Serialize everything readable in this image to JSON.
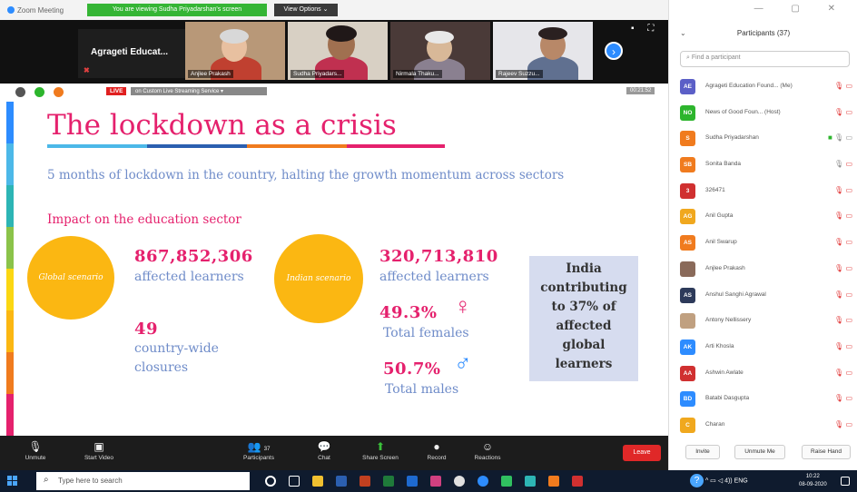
{
  "window": {
    "app_title": "Zoom Meeting",
    "viewing_banner": "You are viewing Sudha Priyadarshan's screen",
    "view_options": "View Options ⌄"
  },
  "thumbnails": {
    "host_tile": "Agrageti Educat...",
    "tiles": [
      {
        "name": "Anjlee Prakash"
      },
      {
        "name": "Sudha Priyadars..."
      },
      {
        "name": "Nirmala Thaku..."
      },
      {
        "name": "Rajeev Suzzu..."
      }
    ]
  },
  "livebar": {
    "live": "LIVE",
    "stream_text": "on Custom Live Streaming Service ▾",
    "time": "00:21:52"
  },
  "slide": {
    "title": "The lockdown as a crisis",
    "subtitle": "5 months of lockdown in the country, halting the growth momentum across sectors",
    "impact_heading": "Impact on the education sector",
    "global_label": "Global scenario",
    "indian_label": "Indian scenario",
    "global_learners_number": "867,852,306",
    "global_learners_label": "affected learners",
    "closures_number": "49",
    "closures_label_1": "country-wide",
    "closures_label_2": "closures",
    "india_learners_number": "320,713,810",
    "india_learners_label": "affected learners",
    "female_pct": "49.3%",
    "female_label": "Total females",
    "male_pct": "50.7%",
    "male_label": "Total males",
    "female_symbol": "♀",
    "male_symbol": "♂",
    "callout_lines": [
      "India",
      "contributing",
      "to 37% of",
      "affected",
      "global",
      "learners"
    ]
  },
  "toolbar": {
    "unmute": "Unmute",
    "start_video": "Start Video",
    "participants": "Participants",
    "participants_count": "37",
    "chat": "Chat",
    "share_screen": "Share Screen",
    "record": "Record",
    "reactions": "Reactions",
    "leave": "Leave"
  },
  "panel": {
    "title": "Participants (37)",
    "search_placeholder": "Find a participant",
    "participants": [
      {
        "initials": "AE",
        "name": "Agrageti Education Found... (Me)",
        "color": "#5b5fc7"
      },
      {
        "initials": "NO",
        "name": "News of Good Foun... (Host)",
        "color": "#2db52d"
      },
      {
        "initials": "S",
        "name": "Sudha Priyadarshan",
        "color": "#f07b1e"
      },
      {
        "initials": "SB",
        "name": "Sonita Banda",
        "color": "#f07b1e"
      },
      {
        "initials": "3",
        "name": "326471",
        "color": "#d03030"
      },
      {
        "initials": "AG",
        "name": "Anil Gupta",
        "color": "#f0a81e"
      },
      {
        "initials": "AS",
        "name": "Anil Swarup",
        "color": "#f07b1e"
      },
      {
        "initials": "",
        "name": "Anjlee Prakash",
        "color": "#8a6a5a"
      },
      {
        "initials": "AS",
        "name": "Anshul Sanghi Agrawal",
        "color": "#2d3a5a"
      },
      {
        "initials": "",
        "name": "Antony Nellissery",
        "color": "#c0a080"
      },
      {
        "initials": "AK",
        "name": "Arti Khosla",
        "color": "#2d8cff"
      },
      {
        "initials": "AA",
        "name": "Ashwin Awlate",
        "color": "#d03030"
      },
      {
        "initials": "BD",
        "name": "Batabi Dasgupta",
        "color": "#2d8cff"
      },
      {
        "initials": "C",
        "name": "Charan",
        "color": "#f0a81e"
      }
    ],
    "invite": "Invite",
    "unmute_me": "Unmute Me",
    "raise_hand": "Raise Hand"
  },
  "taskbar": {
    "search_placeholder": "Type here to search",
    "tray": "^ ▭ ◁ 4)) ENG",
    "time": "10:22",
    "date": "08-09-2020"
  }
}
